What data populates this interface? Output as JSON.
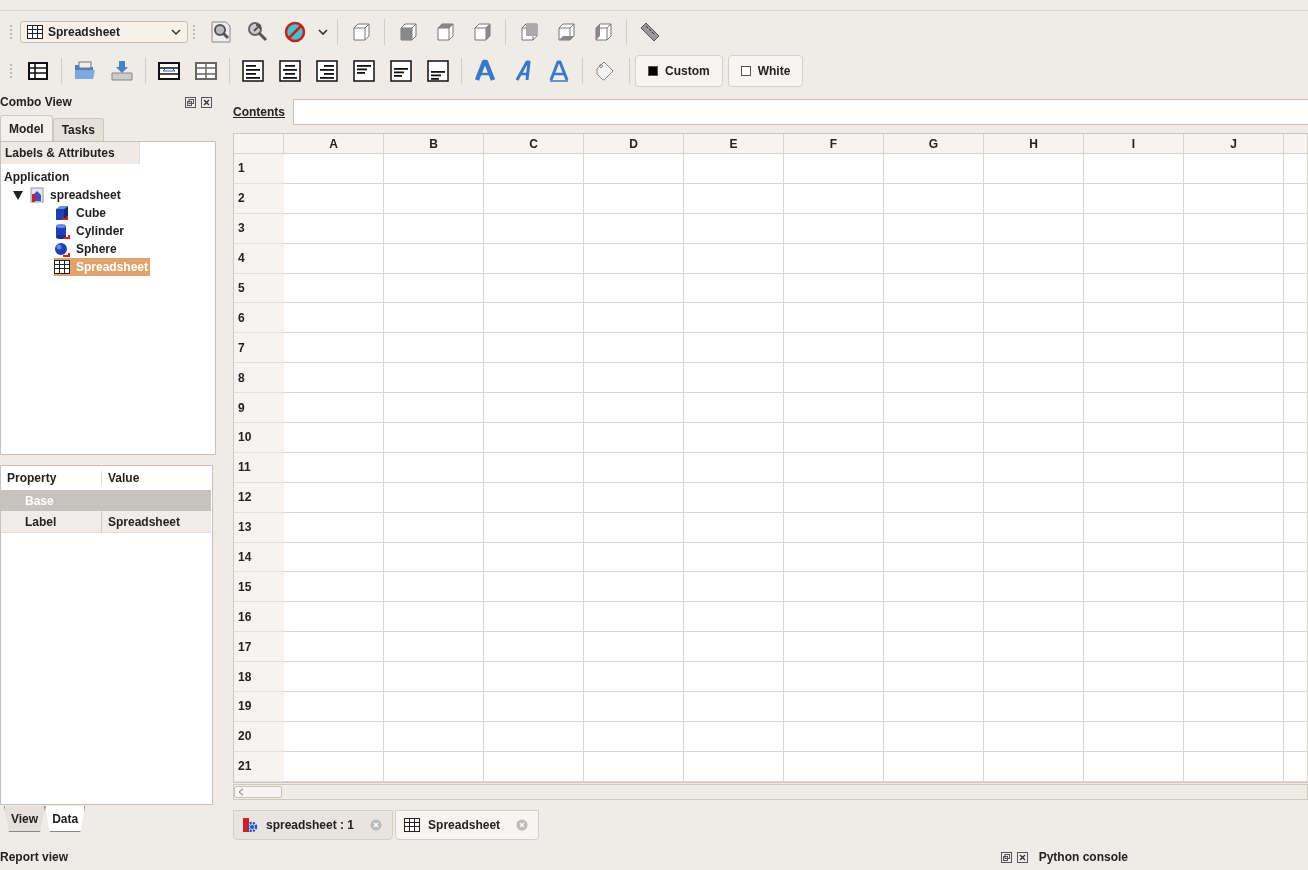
{
  "toolbar": {
    "workbench": "Spreadsheet"
  },
  "color_buttons": [
    {
      "label": "Custom",
      "color": "#000000"
    },
    {
      "label": "White",
      "color": "#ffffff"
    }
  ],
  "combo_view": {
    "title": "Combo View",
    "tabs": [
      {
        "label": "Model",
        "selected": true
      },
      {
        "label": "Tasks",
        "selected": false
      }
    ],
    "tree": {
      "header": "Labels & Attributes",
      "root": "Application",
      "items": [
        {
          "label": "spreadsheet",
          "kind": "document",
          "expanded": true,
          "selected": false,
          "children": [
            {
              "label": "Cube",
              "kind": "cube",
              "selected": false
            },
            {
              "label": "Cylinder",
              "kind": "cylinder",
              "selected": false
            },
            {
              "label": "Sphere",
              "kind": "sphere",
              "selected": false
            },
            {
              "label": "Spreadsheet",
              "kind": "sheet",
              "selected": true
            }
          ]
        }
      ]
    },
    "properties": {
      "columns": [
        "Property",
        "Value"
      ],
      "rows": [
        {
          "kind": "group",
          "property": "Base"
        },
        {
          "kind": "item",
          "property": "Label",
          "value": "Spreadsheet"
        }
      ]
    },
    "bottom_tabs": [
      {
        "label": "View",
        "selected": false
      },
      {
        "label": "Data",
        "selected": true
      }
    ]
  },
  "contents": {
    "label": "Contents"
  },
  "sheet": {
    "columns": [
      "A",
      "B",
      "C",
      "D",
      "E",
      "F",
      "G",
      "H",
      "I",
      "J"
    ],
    "rows": [
      "1",
      "2",
      "3",
      "4",
      "5",
      "6",
      "7",
      "8",
      "9",
      "10",
      "11",
      "12",
      "13",
      "14",
      "15",
      "16",
      "17",
      "18",
      "19",
      "20",
      "21"
    ]
  },
  "document_tabs": [
    {
      "label": "spreadsheet : 1",
      "kind": "document",
      "selected": false
    },
    {
      "label": "Spreadsheet",
      "kind": "sheet",
      "selected": true
    }
  ],
  "report_view": {
    "title": "Report view"
  },
  "python_console": {
    "title": "Python console"
  }
}
